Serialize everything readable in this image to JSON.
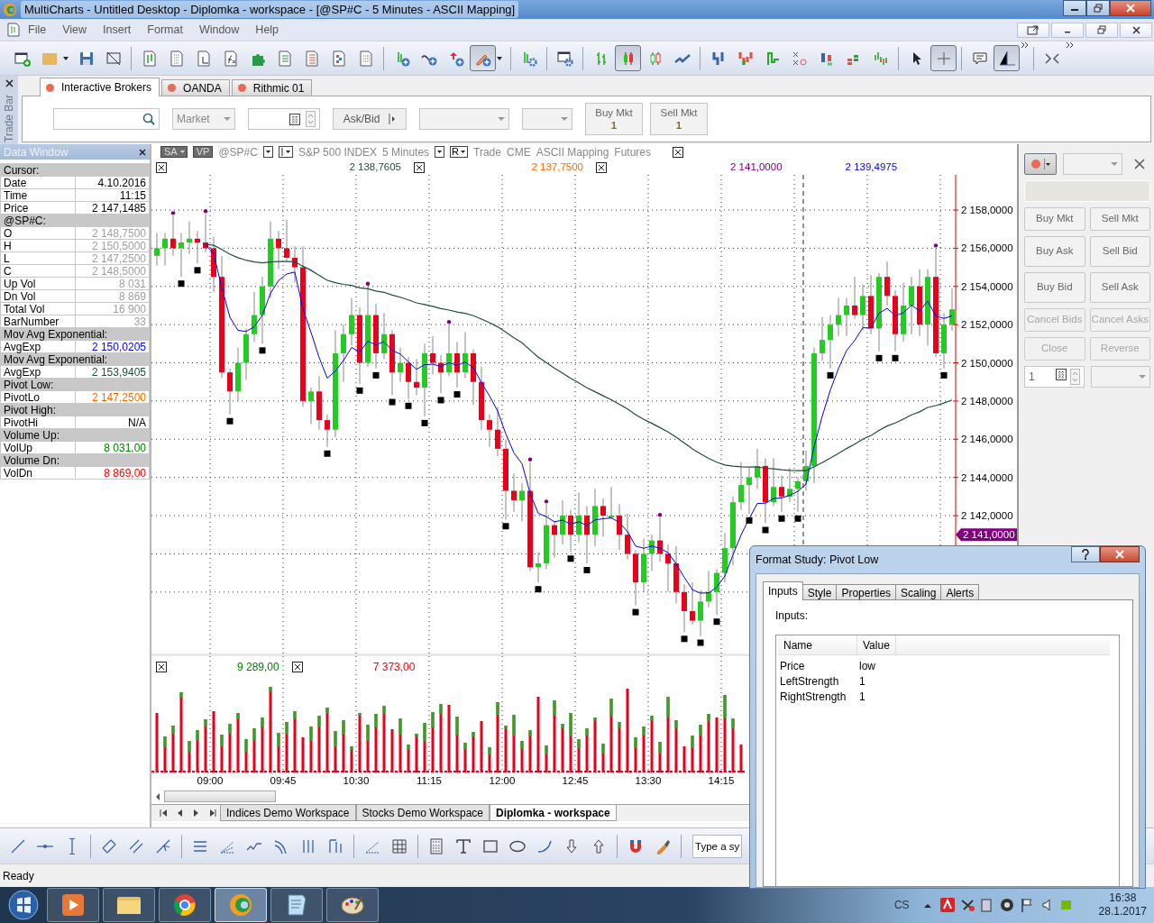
{
  "window": {
    "title": "MultiCharts - Untitled Desktop - Diplomka - workspace - [@SP#C - 5 Minutes - ASCII Mapping]"
  },
  "menu": [
    "File",
    "View",
    "Insert",
    "Format",
    "Window",
    "Help"
  ],
  "toolbar": [
    {
      "pressed": false
    },
    {
      "pressed": false
    },
    {
      "pressed": false
    },
    {
      "pressed": false
    },
    {
      "pressed": false
    },
    {
      "pressed": false
    },
    {
      "pressed": false
    },
    {
      "pressed": false
    },
    {
      "pressed": false
    },
    {
      "pressed": false
    },
    {
      "pressed": false
    },
    {
      "pressed": false
    },
    {
      "pressed": false
    },
    {
      "pressed": false
    },
    {
      "pressed": false
    },
    {
      "pressed": false
    },
    {
      "pressed": true
    },
    {
      "pressed": false
    },
    {
      "pressed": false
    },
    {
      "pressed": false
    },
    {
      "pressed": true
    },
    {
      "pressed": false
    },
    {
      "pressed": false
    },
    {
      "pressed": false
    },
    {
      "pressed": false
    },
    {
      "pressed": false
    },
    {
      "pressed": false
    },
    {
      "pressed": false
    },
    {
      "pressed": false
    },
    {
      "pressed": false
    },
    {
      "pressed": false
    },
    {
      "pressed": true
    },
    {
      "pressed": false
    },
    {
      "pressed": true
    }
  ],
  "trade_bar": {
    "title": "Trade Bar",
    "tabs": [
      {
        "label": "Interactive Brokers",
        "selected": true
      },
      {
        "label": "OANDA",
        "selected": false
      },
      {
        "label": "Rithmic 01",
        "selected": false
      }
    ],
    "order_type": "Market",
    "price_mode": "Ask/Bid",
    "buttons": [
      {
        "label": "Buy Mkt",
        "quantity": "1"
      },
      {
        "label": "Sell Mkt",
        "quantity": "1"
      }
    ]
  },
  "data_window": {
    "title": "Data Window",
    "rows": [
      {
        "kind": "section",
        "label": "Cursor:"
      },
      {
        "kind": "value",
        "label": "Date",
        "value": "4.10.2016",
        "color": "#000000"
      },
      {
        "kind": "value",
        "label": "Time",
        "value": "11:15",
        "color": "#000000"
      },
      {
        "kind": "value",
        "label": "Price",
        "value": "2 147,1485",
        "color": "#000000"
      },
      {
        "kind": "section",
        "label": "@SP#C:"
      },
      {
        "kind": "value",
        "label": "O",
        "value": "2 148,7500",
        "color": "#a0a0a0"
      },
      {
        "kind": "value",
        "label": "H",
        "value": "2 150,5000",
        "color": "#a0a0a0"
      },
      {
        "kind": "value",
        "label": "L",
        "value": "2 147,2500",
        "color": "#a0a0a0"
      },
      {
        "kind": "value",
        "label": "C",
        "value": "2 148,5000",
        "color": "#a0a0a0"
      },
      {
        "kind": "value",
        "label": "Up Vol",
        "value": "8 031",
        "color": "#a0a0a0"
      },
      {
        "kind": "value",
        "label": "Dn Vol",
        "value": "8 869",
        "color": "#a0a0a0"
      },
      {
        "kind": "value",
        "label": "Total Vol",
        "value": "16 900",
        "color": "#a0a0a0"
      },
      {
        "kind": "value",
        "label": "BarNumber",
        "value": "33",
        "color": "#a0a0a0"
      },
      {
        "kind": "section",
        "label": "Mov Avg Exponential:"
      },
      {
        "kind": "value",
        "label": "AvgExp",
        "value": "2 150,0205",
        "color": "#0000ff"
      },
      {
        "kind": "section",
        "label": "Mov Avg Exponential:"
      },
      {
        "kind": "value",
        "label": "AvgExp",
        "value": "2 153,9405",
        "color": "#1e4d3c"
      },
      {
        "kind": "section",
        "label": "Pivot Low:"
      },
      {
        "kind": "value",
        "label": "PivotLo",
        "value": "2 147,2500",
        "color": "#ff6a00"
      },
      {
        "kind": "section",
        "label": "Pivot High:"
      },
      {
        "kind": "value",
        "label": "PivotHi",
        "value": "N/A",
        "color": "#000000"
      },
      {
        "kind": "section",
        "label": "Volume Up:"
      },
      {
        "kind": "value",
        "label": "VolUp",
        "value": "8 031,00",
        "color": "#008000"
      },
      {
        "kind": "section",
        "label": "Volume Dn:"
      },
      {
        "kind": "value",
        "label": "VolDn",
        "value": "8 869,00",
        "color": "#ff0000"
      }
    ]
  },
  "chart": {
    "header": [
      {
        "kind": "split",
        "label": "SA"
      },
      {
        "kind": "tag",
        "label": "VP"
      },
      {
        "kind": "text",
        "label": "@SP#C"
      },
      {
        "kind": "caret"
      },
      {
        "kind": "bars"
      },
      {
        "kind": "text",
        "label": "S&P 500 INDEX"
      },
      {
        "kind": "text",
        "label": "5 Minutes"
      },
      {
        "kind": "caret"
      },
      {
        "kind": "boxed",
        "label": "R"
      },
      {
        "kind": "text",
        "label": "Trade"
      },
      {
        "kind": "text",
        "label": "CME"
      },
      {
        "kind": "text",
        "label": "ASCII Mapping"
      },
      {
        "kind": "text",
        "label": "Futures"
      },
      {
        "kind": "close"
      }
    ],
    "price_pane": {
      "closable": true,
      "study_values": [
        {
          "value": "2 138,7605",
          "color": "#1e4d3c",
          "closable": true
        },
        {
          "value": "2 137,7500",
          "color": "#ff6a00",
          "closable": true
        },
        {
          "value": "2 141,0000",
          "color": "#800080",
          "closable": false
        },
        {
          "value": "2 139,4975",
          "color": "#0000ff",
          "closable": false
        }
      ],
      "axis_labels": [
        "2 158,0000",
        "2 156,0000",
        "2 154,0000",
        "2 152,0000",
        "2 150,0000",
        "2 148,0000",
        "2 146,0000",
        "2 144,0000",
        "2 142,0000"
      ],
      "price_marker": {
        "label": "2 141,0000",
        "color": "#800080"
      }
    },
    "volume_pane": {
      "closable": true,
      "study_values": [
        {
          "value": "9 289,00",
          "color": "#008000",
          "closable": true
        },
        {
          "value": "7 373,00",
          "color": "#ff0000",
          "closable": false
        }
      ]
    },
    "time_axis": [
      "09:00",
      "09:45",
      "10:30",
      "11:15",
      "12:00",
      "12:45",
      "13:30",
      "14:15"
    ]
  },
  "workspace_tabs": [
    {
      "label": "Indices Demo Workspace",
      "selected": false
    },
    {
      "label": "Stocks Demo Workspace",
      "selected": false
    },
    {
      "label": "Diplomka - workspace",
      "selected": true
    }
  ],
  "order_panel": {
    "buttons": [
      {
        "label": "Buy Mkt",
        "disabled": false
      },
      {
        "label": "Sell Mkt",
        "disabled": false
      },
      {
        "label": "Buy Ask",
        "disabled": false
      },
      {
        "label": "Sell Bid",
        "disabled": false
      },
      {
        "label": "Buy Bid",
        "disabled": false
      },
      {
        "label": "Sell Ask",
        "disabled": false
      },
      {
        "label": "Cancel Bids",
        "disabled": true
      },
      {
        "label": "Cancel Asks",
        "disabled": true
      },
      {
        "label": "Close",
        "disabled": true
      },
      {
        "label": "Reverse",
        "disabled": true
      }
    ],
    "quantity": "1"
  },
  "drawing_toolbar": {
    "symbol_field": "Type a sy"
  },
  "status_bar": "Ready",
  "dialog": {
    "title": "Format Study: Pivot Low",
    "tabs": [
      {
        "label": "Inputs",
        "selected": true
      },
      {
        "label": "Style",
        "selected": false
      },
      {
        "label": "Properties",
        "selected": false
      },
      {
        "label": "Scaling",
        "selected": false
      },
      {
        "label": "Alerts",
        "selected": false
      }
    ],
    "section": "Inputs:",
    "columns": [
      "Name",
      "Value"
    ],
    "rows": [
      {
        "name": "Price",
        "value": "low"
      },
      {
        "name": "LeftStrength",
        "value": "1"
      },
      {
        "name": "RightStrength",
        "value": "1"
      }
    ]
  },
  "taskbar": {
    "apps": [
      {
        "active": false
      },
      {
        "active": false
      },
      {
        "active": false
      },
      {
        "active": true
      },
      {
        "active": false
      },
      {
        "active": false
      }
    ],
    "language": "CS",
    "time": "16:38",
    "date": "28.1.2017"
  }
}
